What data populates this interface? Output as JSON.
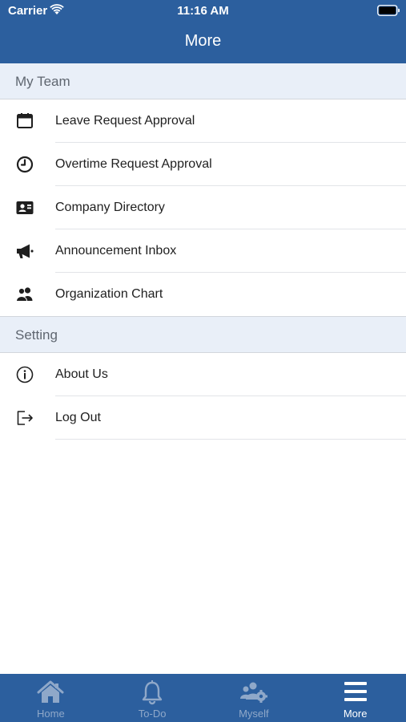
{
  "status_bar": {
    "carrier": "Carrier",
    "time": "11:16 AM"
  },
  "header": {
    "title": "More"
  },
  "sections": [
    {
      "title": "My Team",
      "items": [
        {
          "label": "Leave Request Approval",
          "icon": "calendar-icon"
        },
        {
          "label": "Overtime Request Approval",
          "icon": "clock-icon"
        },
        {
          "label": "Company Directory",
          "icon": "contact-card-icon"
        },
        {
          "label": "Announcement Inbox",
          "icon": "megaphone-icon"
        },
        {
          "label": "Organization Chart",
          "icon": "users-icon"
        }
      ]
    },
    {
      "title": "Setting",
      "items": [
        {
          "label": "About Us",
          "icon": "info-icon"
        },
        {
          "label": "Log Out",
          "icon": "logout-icon"
        }
      ]
    }
  ],
  "tab_bar": {
    "tabs": [
      {
        "label": "Home",
        "icon": "home-icon",
        "active": false
      },
      {
        "label": "To-Do",
        "icon": "bell-icon",
        "active": false
      },
      {
        "label": "Myself",
        "icon": "users-gear-icon",
        "active": false
      },
      {
        "label": "More",
        "icon": "menu-icon",
        "active": true
      }
    ]
  },
  "colors": {
    "brand": "#2c5f9e",
    "section_background": "#e9eff8",
    "tab_inactive": "#8fa8c9",
    "tab_active": "#ffffff"
  }
}
